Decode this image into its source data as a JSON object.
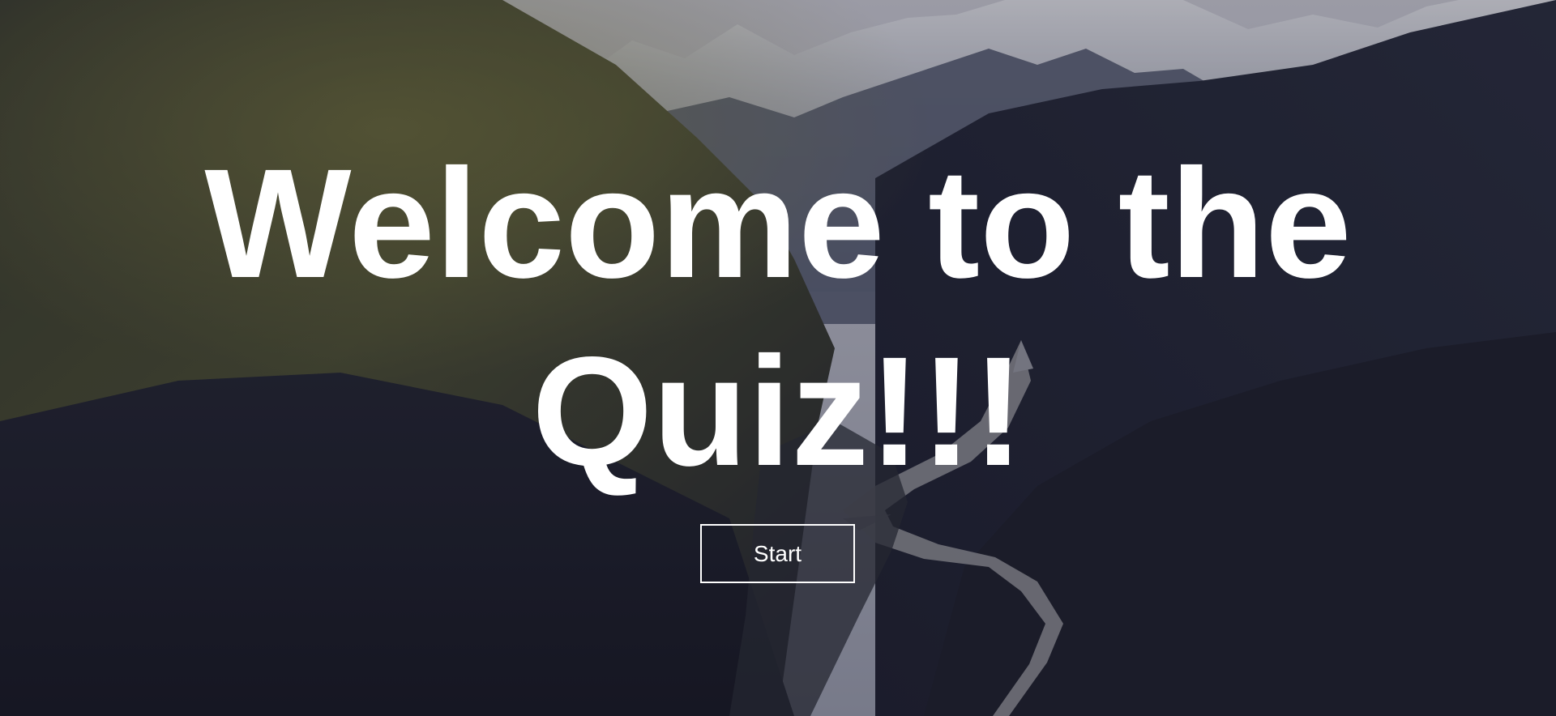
{
  "hero": {
    "title": "Welcome to the Quiz!!!",
    "start_label": "Start"
  },
  "background": {
    "description": "",
    "overlay_color": "#121222"
  },
  "colors": {
    "text": "#ffffff",
    "button_border": "#ffffff"
  }
}
